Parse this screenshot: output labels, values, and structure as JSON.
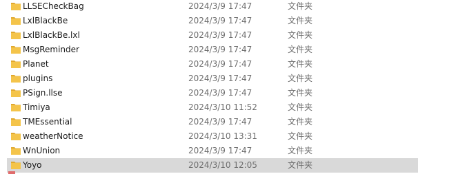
{
  "file_list": {
    "items": [
      {
        "name": "LLSECheckBag",
        "modified": "2024/3/9 17:47",
        "type": "文件夹",
        "icon": "folder-icon"
      },
      {
        "name": "LxlBlackBe",
        "modified": "2024/3/9 17:47",
        "type": "文件夹",
        "icon": "folder-icon"
      },
      {
        "name": "LxlBlackBe.lxl",
        "modified": "2024/3/9 17:47",
        "type": "文件夹",
        "icon": "folder-icon"
      },
      {
        "name": "MsgReminder",
        "modified": "2024/3/9 17:47",
        "type": "文件夹",
        "icon": "folder-icon"
      },
      {
        "name": "Planet",
        "modified": "2024/3/9 17:47",
        "type": "文件夹",
        "icon": "folder-icon"
      },
      {
        "name": "plugins",
        "modified": "2024/3/9 17:47",
        "type": "文件夹",
        "icon": "folder-icon"
      },
      {
        "name": "PSign.llse",
        "modified": "2024/3/9 17:47",
        "type": "文件夹",
        "icon": "folder-icon"
      },
      {
        "name": "Timiya",
        "modified": "2024/3/10 11:52",
        "type": "文件夹",
        "icon": "folder-icon"
      },
      {
        "name": "TMEssential",
        "modified": "2024/3/9 17:47",
        "type": "文件夹",
        "icon": "folder-icon"
      },
      {
        "name": "weatherNotice",
        "modified": "2024/3/10 13:31",
        "type": "文件夹",
        "icon": "folder-icon"
      },
      {
        "name": "WnUnion",
        "modified": "2024/3/9 17:47",
        "type": "文件夹",
        "icon": "folder-icon"
      },
      {
        "name": "Yoyo",
        "modified": "2024/3/10 12:05",
        "type": "文件夹",
        "icon": "folder-icon",
        "selected": true
      }
    ]
  },
  "colors": {
    "folder": "#f4c44a",
    "folder_dark": "#e0a82e",
    "selected_row": "#d9d9d9"
  }
}
